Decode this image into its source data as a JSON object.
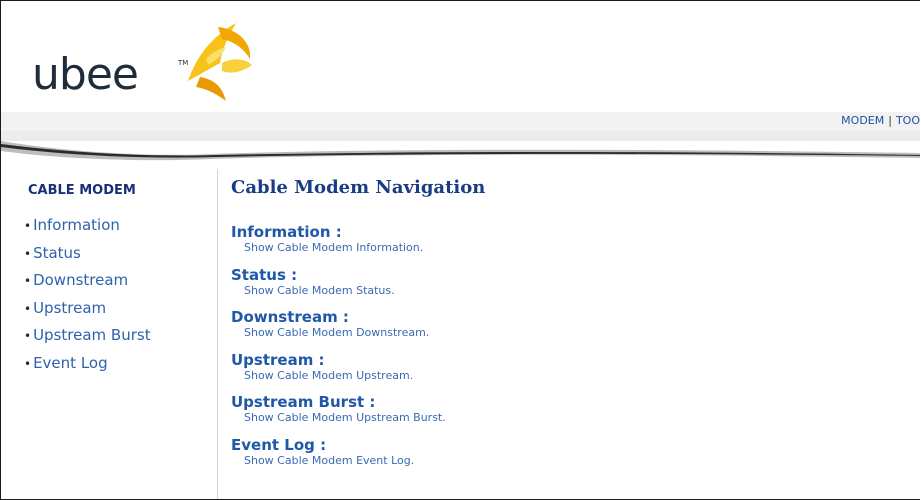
{
  "brand": {
    "logo_text": "ubee",
    "tm": "TM"
  },
  "topnav": {
    "items": [
      "MODEM",
      "TOO"
    ]
  },
  "sidebar": {
    "title": "CABLE MODEM",
    "items": [
      {
        "label": "Information"
      },
      {
        "label": "Status"
      },
      {
        "label": "Downstream"
      },
      {
        "label": "Upstream"
      },
      {
        "label": "Upstream Burst"
      },
      {
        "label": "Event Log"
      }
    ]
  },
  "main": {
    "title": "Cable Modem Navigation",
    "sections": [
      {
        "title": "Information :",
        "desc": "Show Cable Modem Information."
      },
      {
        "title": "Status :",
        "desc": "Show Cable Modem Status."
      },
      {
        "title": "Downstream :",
        "desc": "Show Cable Modem Downstream."
      },
      {
        "title": "Upstream :",
        "desc": "Show Cable Modem Upstream."
      },
      {
        "title": "Upstream Burst :",
        "desc": "Show Cable Modem Upstream Burst."
      },
      {
        "title": "Event Log :",
        "desc": "Show Cable Modem Event Log."
      }
    ]
  },
  "colors": {
    "accent": "#1a3b86",
    "link": "#2e62ad",
    "logo_yellow": "#f5b400"
  }
}
